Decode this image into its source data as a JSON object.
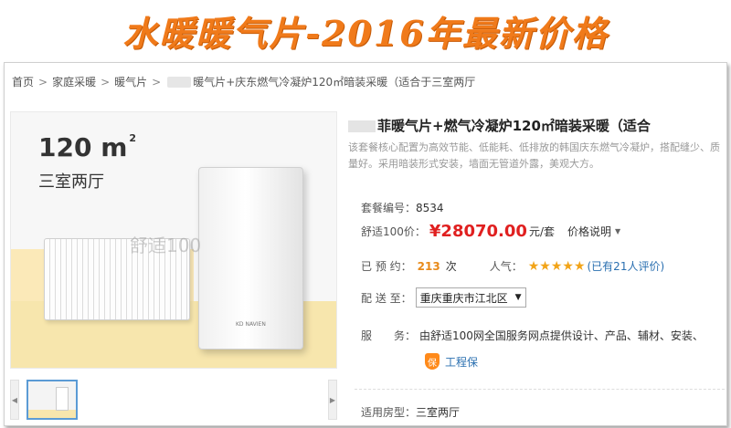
{
  "banner": {
    "title": "水暖暖气片-2016年最新价格"
  },
  "breadcrumb": {
    "home": "首页",
    "cat1": "家庭采暖",
    "cat2": "暖气片",
    "cat3": "暖气片+庆东燃气冷凝炉120㎡暗装采暖（适合于三室两厅"
  },
  "gallery": {
    "area_number": "120",
    "area_unit": "m",
    "area_sup": "2",
    "room_label": "三室两厅",
    "watermark": "舒适100",
    "boiler_brand": "KD NAVIEN"
  },
  "product": {
    "title": "菲暖气片+燃气冷凝炉120㎡暗装采暖（适合",
    "desc": "该套餐核心配置为高效节能、低能耗、低排放的韩国庆东燃气冷凝炉，搭配缝少、质量好。采用暗装形式安装，墙面无管道外露，美观大方。",
    "sku_label": "套餐编号：",
    "sku_value": "8534",
    "price_label": "舒适100价：",
    "price_value": "¥28070.00",
    "price_unit": "元/套",
    "price_note": "价格说明",
    "reserved_label": "已 预 约：",
    "reserved_count": "213",
    "reserved_unit": "次",
    "popularity_label": "人气：",
    "stars": "★★★★★",
    "reviews": "(已有21人评价)",
    "delivery_label": "配 送 至：",
    "delivery_value": "重庆重庆市江北区",
    "service_label": "服　　务：",
    "service_text": "由舒适100网全国服务网点提供设计、产品、辅材、安装、",
    "guarantee_icon": "保",
    "guarantee_text": "工程保",
    "room_type_label": "适用房型：",
    "room_type_value": "三室两厅"
  },
  "colors": {
    "banner": "#f07a1a",
    "price": "#e02020",
    "link": "#2a6fb0",
    "star": "#f2a418"
  }
}
